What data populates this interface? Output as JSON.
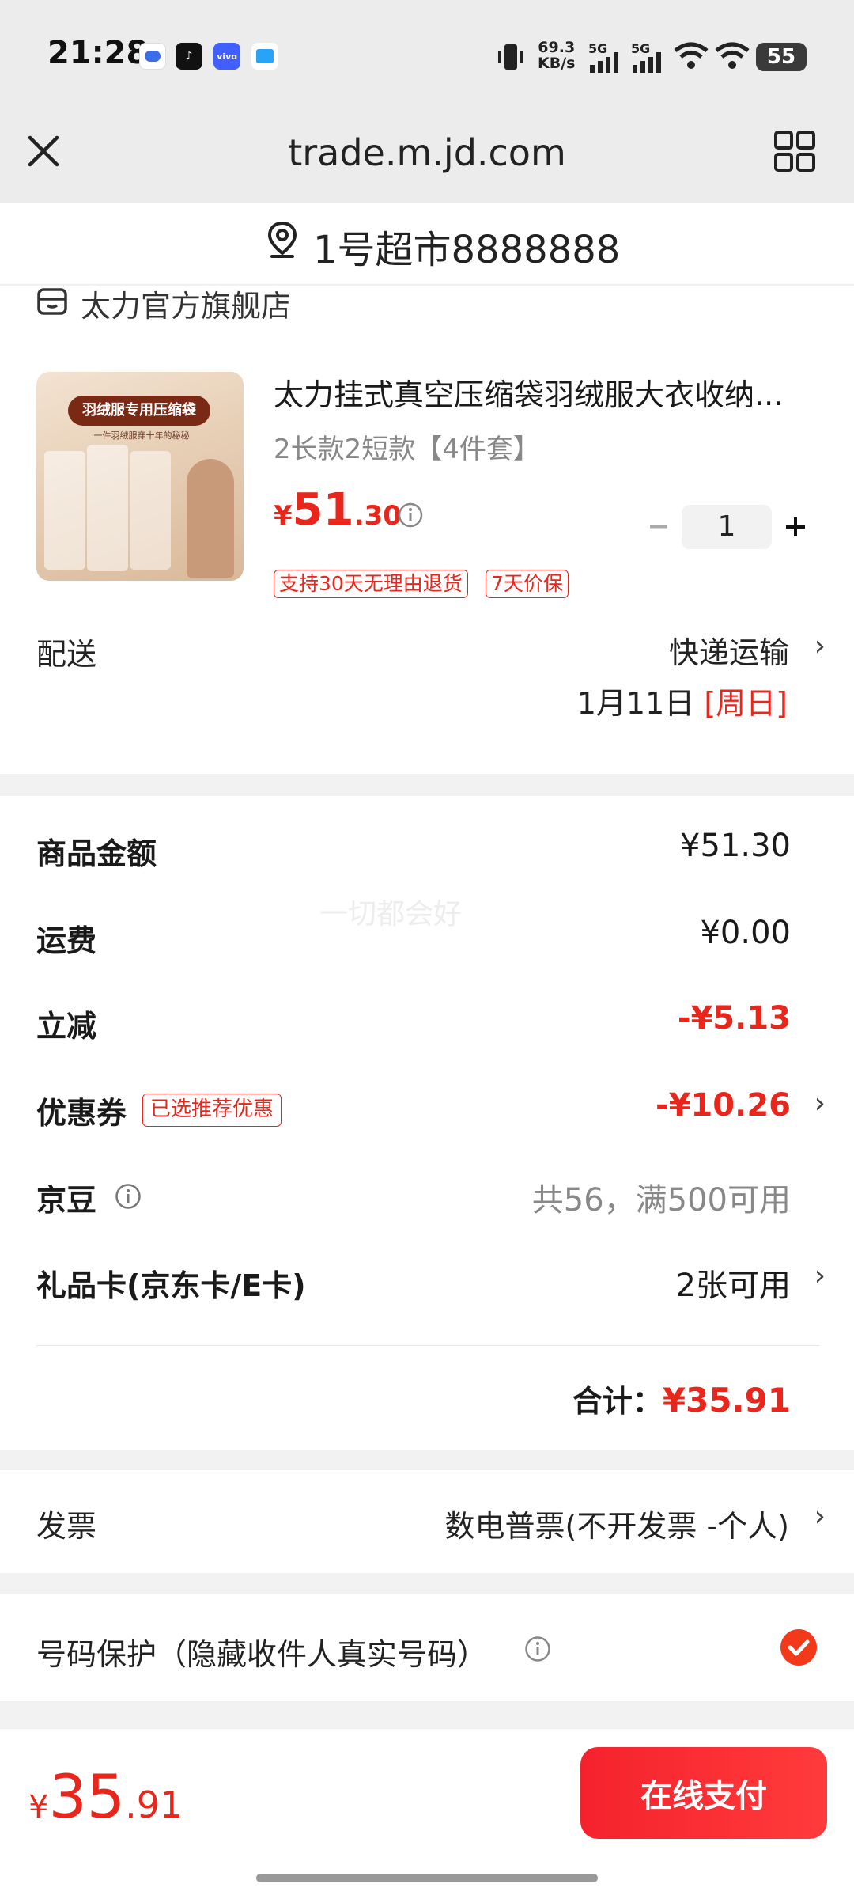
{
  "status_bar": {
    "time": "21:28",
    "net_speed_value": "69.3",
    "net_speed_unit": "KB/s",
    "sig1": "5G",
    "sig2": "5G",
    "battery": "55"
  },
  "browser": {
    "url": "trade.m.jd.com"
  },
  "address": {
    "text": "1号超市8888888"
  },
  "store": {
    "name": "太力官方旗舰店"
  },
  "product": {
    "title": "太力挂式真空压缩袋羽绒服大衣收纳...",
    "spec": "2长款2短款【4件套】",
    "price_symbol": "¥",
    "price_int": "51",
    "price_dec": ".30",
    "quantity": "1",
    "tags": [
      "支持30天无理由退货",
      "7天价保"
    ],
    "image_banner": "羽绒服专用压缩袋",
    "image_sub": "一件羽绒服穿十年的秘秘"
  },
  "delivery": {
    "label": "配送",
    "method": "快递运输",
    "date": "1月11日",
    "weekday": "[周日]"
  },
  "summary": {
    "goods_label": "商品金额",
    "goods_value": "¥51.30",
    "shipping_label": "运费",
    "shipping_value": "¥0.00",
    "discount_label": "立减",
    "discount_value": "-¥5.13",
    "coupon_label": "优惠券",
    "coupon_badge": "已选推荐优惠",
    "coupon_value": "-¥10.26",
    "beans_label": "京豆",
    "beans_value": "共56，满500可用",
    "giftcard_label": "礼品卡(京东卡/E卡)",
    "giftcard_value": "2张可用",
    "total_label": "合计：",
    "total_value": "¥35.91",
    "watermark": "一切都会好"
  },
  "invoice": {
    "label": "发票",
    "value": "数电普票(不开发票 -个人)"
  },
  "privacy": {
    "label": "号码保护（隐藏收件人真实号码）",
    "checked": true
  },
  "footer": {
    "symbol": "¥",
    "amount_int": "35",
    "amount_dec": ".91",
    "pay_label": "在线支付"
  },
  "colors": {
    "accent": "#e8261c",
    "pay_button": "#f5222d"
  }
}
